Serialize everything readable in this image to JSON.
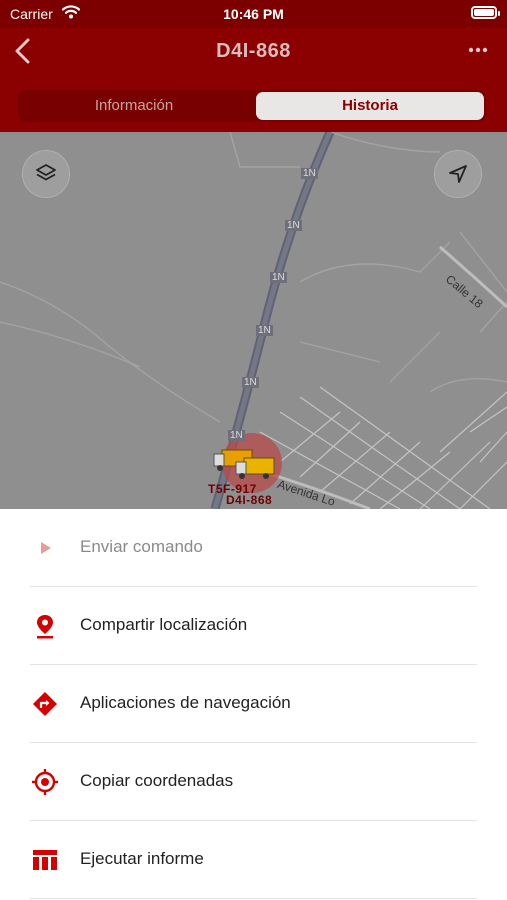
{
  "status_bar": {
    "carrier": "Carrier",
    "time": "10:46 PM"
  },
  "header": {
    "title": "D4I-868",
    "back_icon": "chevron-left-icon",
    "more_icon": "ellipsis-icon",
    "tabs": [
      {
        "label": "Información",
        "selected": false
      },
      {
        "label": "Historia",
        "selected": true
      }
    ]
  },
  "map": {
    "road_labels": [
      "1N",
      "1N",
      "1N",
      "1N",
      "1N",
      "1N"
    ],
    "street_labels": [
      "Calle 18",
      "Avenida Lo"
    ],
    "vehicles": [
      {
        "label": "T5F-917"
      },
      {
        "label": "D4I-868"
      }
    ]
  },
  "menu": [
    {
      "label": "Enviar comando",
      "icon": "play-icon",
      "disabled": true
    },
    {
      "label": "Compartir localización",
      "icon": "location-pin-icon",
      "disabled": false
    },
    {
      "label": "Aplicaciones de navegación",
      "icon": "directions-icon",
      "disabled": false
    },
    {
      "label": "Copiar coordenadas",
      "icon": "crosshair-icon",
      "disabled": false
    },
    {
      "label": "Ejecutar informe",
      "icon": "report-table-icon",
      "disabled": false
    }
  ],
  "colors": {
    "brand": "#8b0000",
    "accent": "#d50000",
    "map_dim": "#8f8f8f"
  }
}
